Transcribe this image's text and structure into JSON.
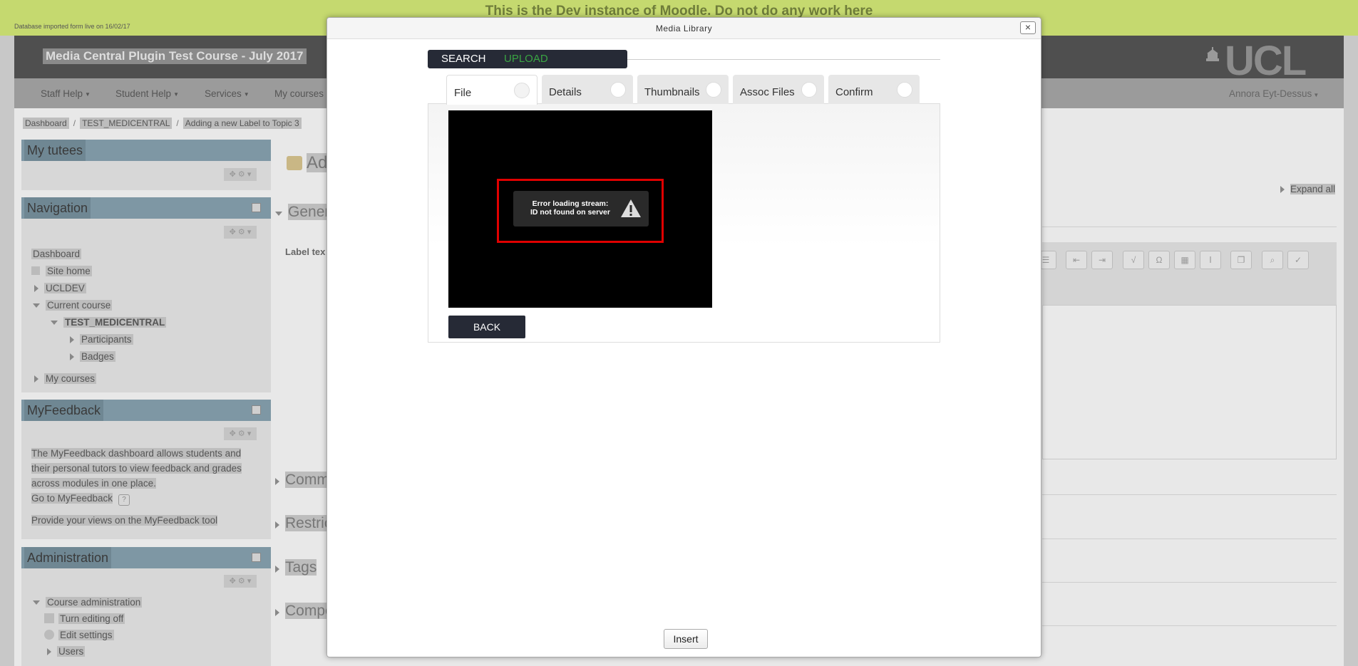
{
  "dev_banner": {
    "title": "This is the Dev instance of Moodle. Do not do any work here",
    "db_note": "Database imported form live on 16/02/17"
  },
  "header": {
    "course_title": "Media Central Plugin Test Course - July 2017",
    "logo_text": "UCL"
  },
  "nav": {
    "items": [
      "Staff Help",
      "Student Help",
      "Services",
      "My courses"
    ],
    "user": "Annora Eyt-Dessus"
  },
  "breadcrumb": [
    "Dashboard",
    "TEST_MEDICENTRAL",
    "Adding a new Label to Topic 3"
  ],
  "blocks": {
    "tutees": {
      "title": "My tutees"
    },
    "navigation": {
      "title": "Navigation",
      "items": {
        "dashboard": "Dashboard",
        "site_home": "Site home",
        "ucldev": "UCLDEV",
        "current_course": "Current course",
        "course": "TEST_MEDICENTRAL",
        "participants": "Participants",
        "badges": "Badges",
        "my_courses": "My courses"
      }
    },
    "myfeedback": {
      "title": "MyFeedback",
      "desc": "The MyFeedback dashboard allows students and their personal tutors to view feedback and grades across modules in one place.",
      "link": "Go to MyFeedback",
      "views": "Provide your views on the MyFeedback tool"
    },
    "administration": {
      "title": "Administration",
      "items": {
        "course_admin": "Course administration",
        "turn_editing": "Turn editing off",
        "edit_settings": "Edit settings",
        "users": "Users"
      }
    }
  },
  "background": {
    "heading_fragment": "Ad",
    "general_fragment": "Gener",
    "label_fragment": "Label tex",
    "common_fragment": "Comm",
    "restrict_fragment": "Restric",
    "tags": "Tags",
    "competencies_fragment": "Compe",
    "expand_all": "Expand all"
  },
  "modal": {
    "title": "Media Library",
    "close_symbol": "×",
    "modes": {
      "search": "SEARCH",
      "upload": "UPLOAD"
    },
    "steps": [
      "File",
      "Details",
      "Thumbnails",
      "Assoc Files",
      "Confirm"
    ],
    "error_line1": "Error loading stream:",
    "error_line2": "ID not found on server",
    "back_label": "BACK",
    "insert_label": "Insert"
  },
  "colors": {
    "dev_banner": "#c5d96f",
    "dark_button": "#262a36",
    "upload_green": "#3aa543",
    "error_red": "#e00000"
  }
}
